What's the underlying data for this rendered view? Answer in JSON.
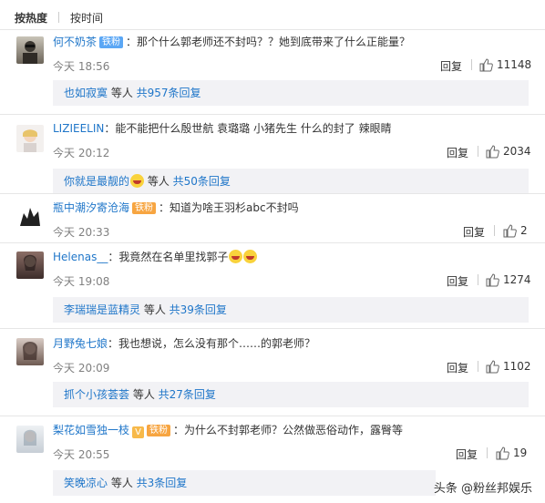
{
  "tabs": [
    "按热度",
    "按时间"
  ],
  "comments": [
    {
      "user": "何不奶茶",
      "badge": "铁粉",
      "text": "：那个什么郭老师还不封吗？？她到底带来了什么正能量？",
      "time": "今天 18:56",
      "reply": "回复",
      "likes": "11148",
      "replies": {
        "user": "也如寂寞",
        "text": " 等人 ",
        "count": "共957条回复"
      }
    },
    {
      "user": "LIZIEELIN",
      "text": "：能不能把什么殷世航 袁璐璐 小猪先生 什么的封了 辣眼睛",
      "time": "今天 20:12",
      "reply": "回复",
      "likes": "2034",
      "replies": {
        "user": "你就是最靓的",
        "text": " 等人 ",
        "count": "共50条回复"
      }
    },
    {
      "user": "瓶中潮汐寄沧海",
      "badge": "铁粉",
      "text": "：知道为啥王羽杉abc不封吗",
      "time": "今天 20:33",
      "reply": "回复",
      "likes": "2"
    },
    {
      "user": "Helenas__",
      "text": "：我竟然在名单里找郭子",
      "time": "今天 19:08",
      "reply": "回复",
      "likes": "1274",
      "replies": {
        "user": "李瑞瑞是蓝精灵",
        "text": " 等人 ",
        "count": "共39条回复"
      }
    },
    {
      "user": "月野兔七娘",
      "text": "：我也想说，怎么没有那个……的郭老师？",
      "time": "今天 20:09",
      "reply": "回复",
      "likes": "1102",
      "replies": {
        "user": "抓个小孩荟荟",
        "text": " 等人 ",
        "count": "共27条回复"
      }
    },
    {
      "user": "梨花如雪独一枝",
      "badge": "铁粉",
      "text": "：为什么不封郭老师？公然做恶俗动作，露臀等",
      "time": "今天 20:55",
      "reply": "回复",
      "likes": "19",
      "replies": {
        "user": "笑晚凉心",
        "text": " 等人 ",
        "count": "共3条回复"
      }
    }
  ],
  "watermark": "头条 @粉丝邦娱乐"
}
